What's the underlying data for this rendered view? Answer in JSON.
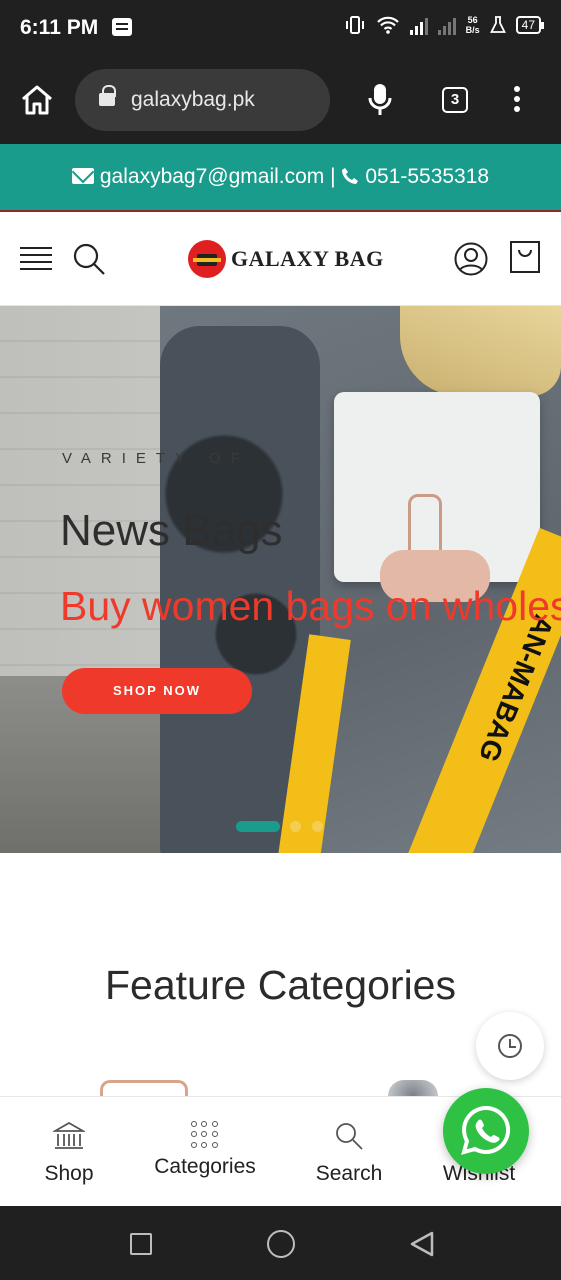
{
  "status_bar": {
    "time": "6:11 PM",
    "net_speed_top": "56",
    "net_speed_bottom": "B/s",
    "battery": "47"
  },
  "browser": {
    "url": "galaxybag.pk",
    "tab_count": "3"
  },
  "contact_bar": {
    "email": "galaxybag7@gmail.com",
    "separator": "|",
    "phone": "051-5535318"
  },
  "site_header": {
    "brand": "GALAXY BAG"
  },
  "hero": {
    "kicker": "VARIETY OF",
    "title": "News Bags",
    "subtitle": "Buy women bags on wholesale",
    "cta": "SHOP NOW",
    "strap_text": "AN-MABAG"
  },
  "feature": {
    "title": "Feature Categories"
  },
  "bottom_nav": {
    "items": [
      {
        "label": "Shop",
        "icon": "bank-icon"
      },
      {
        "label": "Categories",
        "icon": "grid-icon"
      },
      {
        "label": "Search",
        "icon": "search-icon"
      },
      {
        "label": "Wishlist",
        "icon": "heart-icon"
      }
    ]
  },
  "colors": {
    "accent_teal": "#1a9c8c",
    "accent_red": "#ef3a2b",
    "whatsapp_green": "#2fc144",
    "dark_chrome": "#202020"
  }
}
